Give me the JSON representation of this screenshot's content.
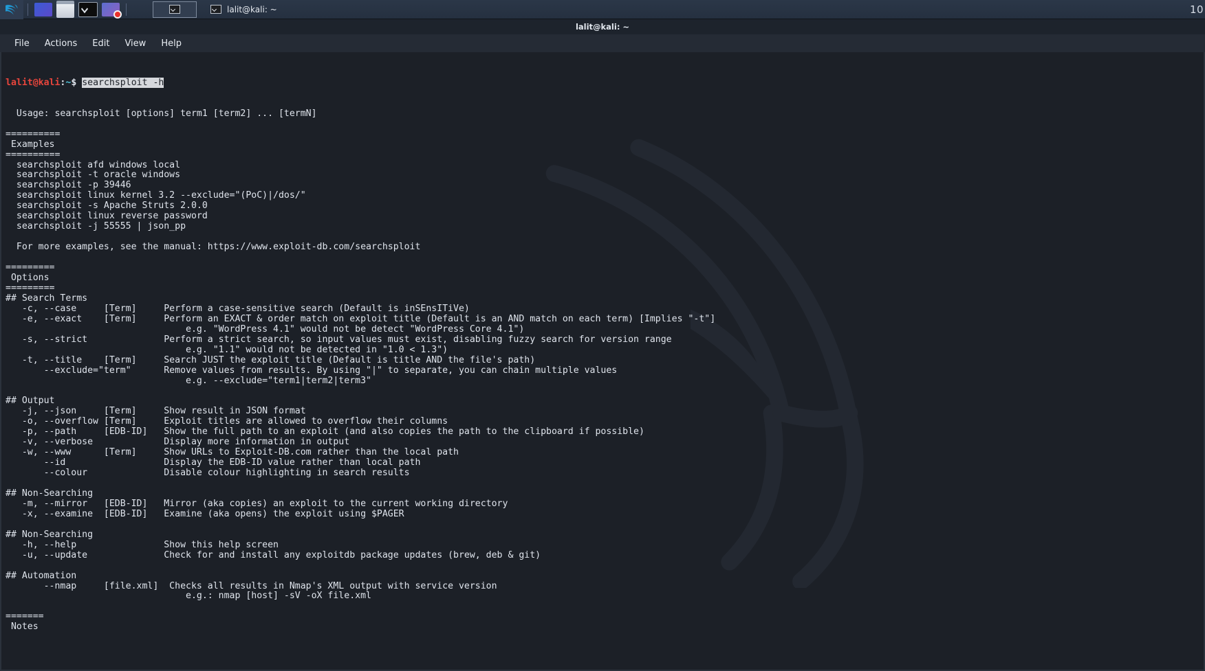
{
  "panel": {
    "logo": "kali-dragon-logo",
    "launchers": [
      {
        "name": "firefox-launcher",
        "label": "Firefox"
      },
      {
        "name": "files-launcher",
        "label": "Files"
      },
      {
        "name": "terminal-launcher",
        "label": "Terminal"
      },
      {
        "name": "burpsuite-launcher",
        "label": "Burp Suite"
      }
    ],
    "task_active": "",
    "window_task_label": "lalit@kali: ~",
    "clock": "10"
  },
  "window": {
    "title": "lalit@kali: ~",
    "menu": [
      "File",
      "Actions",
      "Edit",
      "View",
      "Help"
    ]
  },
  "terminal": {
    "prompt": {
      "user": "lalit",
      "at": "@",
      "host": "kali",
      "colon": ":",
      "path": "~",
      "dollar": "$"
    },
    "command": "searchsploit -h",
    "lines": [
      "  Usage: searchsploit [options] term1 [term2] ... [termN]",
      "",
      "==========",
      " Examples",
      "==========",
      "  searchsploit afd windows local",
      "  searchsploit -t oracle windows",
      "  searchsploit -p 39446",
      "  searchsploit linux kernel 3.2 --exclude=\"(PoC)|/dos/\"",
      "  searchsploit -s Apache Struts 2.0.0",
      "  searchsploit linux reverse password",
      "  searchsploit -j 55555 | json_pp",
      "",
      "  For more examples, see the manual: https://www.exploit-db.com/searchsploit",
      "",
      "=========",
      " Options",
      "=========",
      "## Search Terms",
      "   -c, --case     [Term]     Perform a case-sensitive search (Default is inSEnsITiVe)",
      "   -e, --exact    [Term]     Perform an EXACT & order match on exploit title (Default is an AND match on each term) [Implies \"-t\"]",
      "                                 e.g. \"WordPress 4.1\" would not be detect \"WordPress Core 4.1\")",
      "   -s, --strict              Perform a strict search, so input values must exist, disabling fuzzy search for version range",
      "                                 e.g. \"1.1\" would not be detected in \"1.0 < 1.3\")",
      "   -t, --title    [Term]     Search JUST the exploit title (Default is title AND the file's path)",
      "       --exclude=\"term\"      Remove values from results. By using \"|\" to separate, you can chain multiple values",
      "                                 e.g. --exclude=\"term1|term2|term3\"",
      "",
      "## Output",
      "   -j, --json     [Term]     Show result in JSON format",
      "   -o, --overflow [Term]     Exploit titles are allowed to overflow their columns",
      "   -p, --path     [EDB-ID]   Show the full path to an exploit (and also copies the path to the clipboard if possible)",
      "   -v, --verbose             Display more information in output",
      "   -w, --www      [Term]     Show URLs to Exploit-DB.com rather than the local path",
      "       --id                  Display the EDB-ID value rather than local path",
      "       --colour              Disable colour highlighting in search results",
      "",
      "## Non-Searching",
      "   -m, --mirror   [EDB-ID]   Mirror (aka copies) an exploit to the current working directory",
      "   -x, --examine  [EDB-ID]   Examine (aka opens) the exploit using $PAGER",
      "",
      "## Non-Searching",
      "   -h, --help                Show this help screen",
      "   -u, --update              Check for and install any exploitdb package updates (brew, deb & git)",
      "",
      "## Automation",
      "       --nmap     [file.xml]  Checks all results in Nmap's XML output with service version",
      "                                 e.g.: nmap [host] -sV -oX file.xml",
      "",
      "=======",
      " Notes"
    ]
  },
  "colors": {
    "terminal_bg": "#1c2027",
    "panel_bg": "#2b3748",
    "prompt_red": "#e8453c",
    "prompt_cyan": "#4fc3d9",
    "text": "#dfe4ec",
    "selection_bg": "#d6d8dc"
  }
}
